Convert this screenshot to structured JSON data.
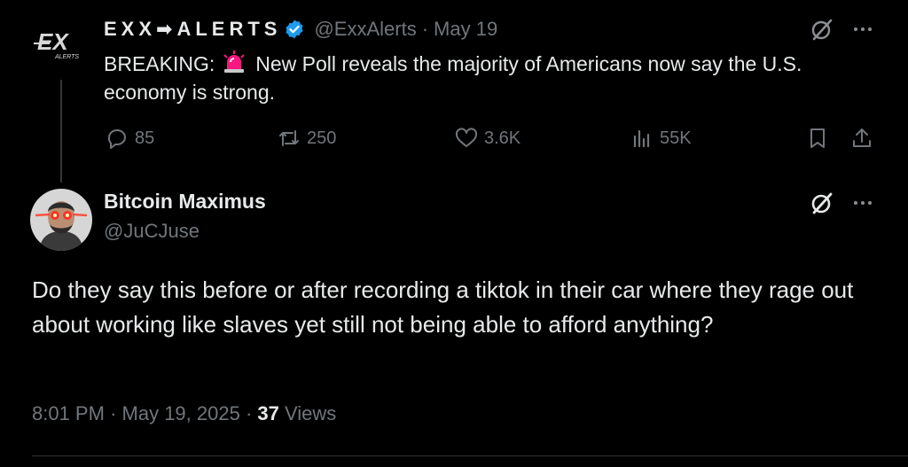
{
  "quoted": {
    "display_name": "EXX➡ALERTS",
    "handle": "@ExxAlerts",
    "separator": "·",
    "date": "May 19",
    "text_prefix": "BREAKING:",
    "text_body": "New Poll reveals the majority of Americans now say the U.S. economy is strong.",
    "logo_text": "EX",
    "logo_subtext": "ALERTS",
    "stats": {
      "replies": "85",
      "reposts": "250",
      "likes": "3.6K",
      "views": "55K"
    }
  },
  "reply": {
    "display_name": "Bitcoin Maximus",
    "handle": "@JuCJuse",
    "text": "Do they say this before or after recording a tiktok in their car where they rage out about working like slaves yet still not being able to afford anything?",
    "time": "8:01 PM",
    "separator": "·",
    "date": "May 19, 2025",
    "separator2": "·",
    "view_count": "37",
    "views_label": "Views"
  },
  "colors": {
    "background": "#000000",
    "text": "#e7e9ea",
    "muted": "#71767b",
    "verified": "#1d9bf0",
    "siren": "#f91880"
  },
  "icons": [
    "exx-logo-icon",
    "verified-badge-icon",
    "siren-icon",
    "grok-icon",
    "more-icon",
    "reply-icon",
    "repost-icon",
    "like-icon",
    "views-icon",
    "bookmark-icon",
    "share-icon",
    "avatar"
  ]
}
